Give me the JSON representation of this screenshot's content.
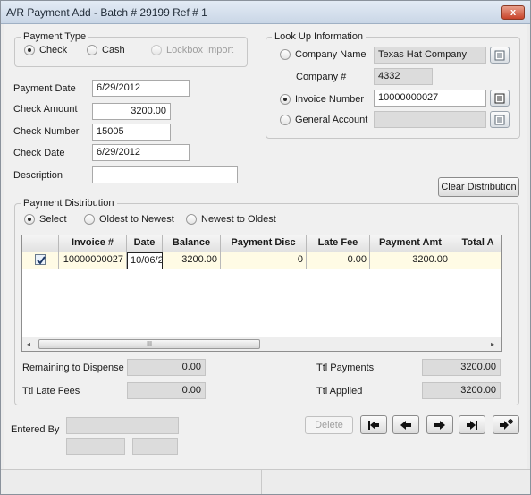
{
  "window": {
    "title": "A/R Payment Add - Batch # 29199 Ref # 1",
    "close_glyph": "x"
  },
  "payment_type": {
    "legend": "Payment Type",
    "options": [
      "Check",
      "Cash",
      "Lockbox Import"
    ],
    "selected": "Check"
  },
  "form": {
    "payment_date_label": "Payment Date",
    "payment_date": "6/29/2012",
    "check_amount_label": "Check Amount",
    "check_amount": "3200.00",
    "check_number_label": "Check Number",
    "check_number": "15005",
    "check_date_label": "Check Date",
    "check_date": "6/29/2012",
    "description_label": "Description",
    "description": ""
  },
  "lookup": {
    "legend": "Look Up Information",
    "company_name_label": "Company Name",
    "company_name": "Texas Hat Company",
    "company_num_label": "Company #",
    "company_num": "4332",
    "invoice_number_label": "Invoice Number",
    "invoice_number": "10000000027",
    "general_account_label": "General Account",
    "general_account": "",
    "selected": "Invoice Number"
  },
  "clear_distribution_label": "Clear Distribution",
  "distribution": {
    "legend": "Payment Distribution",
    "options": [
      "Select",
      "Oldest to Newest",
      "Newest to Oldest"
    ],
    "selected": "Select",
    "columns": [
      "",
      "Invoice #",
      "Date",
      "Balance",
      "Payment Disc",
      "Late Fee",
      "Payment Amt",
      "Total A"
    ],
    "rows": [
      {
        "checked": true,
        "invoice": "10000000027",
        "date": "10/06/2",
        "balance": "3200.00",
        "payment_disc": "0",
        "late_fee": "0.00",
        "payment_amt": "3200.00",
        "total": ""
      }
    ],
    "scroll_left": "◂",
    "scroll_right": "▸",
    "scroll_grip": "III"
  },
  "totals": {
    "remaining_label": "Remaining to Dispense",
    "remaining": "0.00",
    "late_fees_label": "Ttl Late Fees",
    "late_fees": "0.00",
    "payments_label": "Ttl Payments",
    "payments": "3200.00",
    "applied_label": "Ttl Applied",
    "applied": "3200.00"
  },
  "footer": {
    "entered_by_label": "Entered By",
    "delete_label": "Delete"
  },
  "colors": {
    "selected_row_bg": "#fffbe5",
    "title_bar": "#c9d6e6"
  }
}
